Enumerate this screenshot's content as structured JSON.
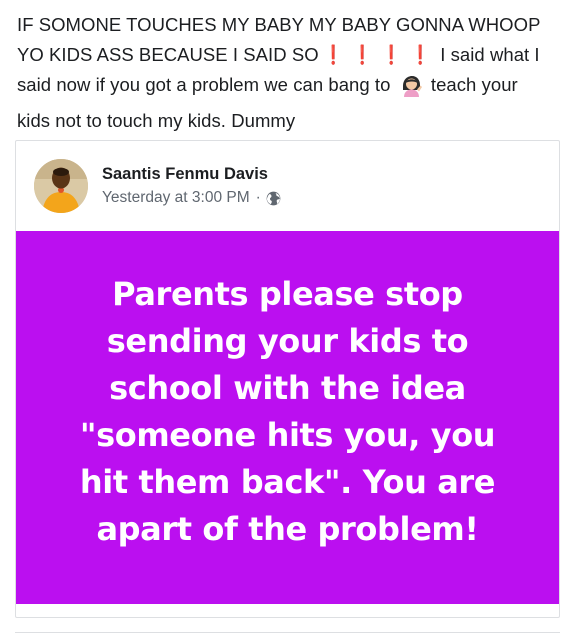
{
  "post": {
    "line1": "IF SOMONE TOUCHES MY BABY MY BABY GONNA WHOOP",
    "line2_before": "YO KIDS ASS BECAUSE I SAID SO",
    "exclamation": "❗",
    "line2_after": "I said what I",
    "line3_before": "said now if you got a problem we can bang to",
    "line3_after": "teach your",
    "line4": "kids not to touch my kids. Dummy"
  },
  "shared_post": {
    "author": "Saantis Fenmu Davis",
    "timestamp": "Yesterday at 3:00 PM",
    "separator": "·",
    "privacy_icon": "globe-icon",
    "panel_color": "#bb0ff0",
    "panel_text": [
      "Parents please stop",
      "sending your kids to",
      "school with the idea",
      "\"someone hits you, you",
      "hit them back\". You are",
      "apart of the problem!"
    ]
  },
  "colors": {
    "text_primary": "#1c1e21",
    "text_secondary": "#606770",
    "exclamation_red": "#e0252b",
    "border": "#dddfe2"
  }
}
